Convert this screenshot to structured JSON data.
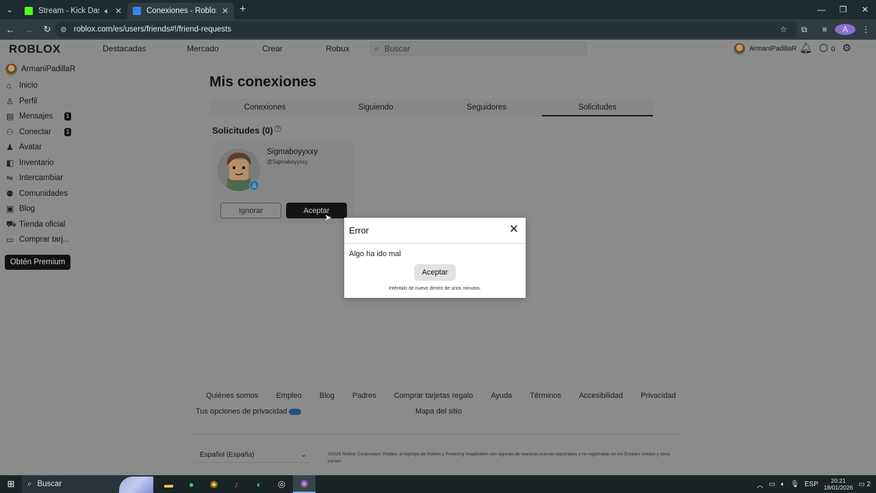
{
  "browser": {
    "tabs": [
      {
        "title": "Stream - Kick Dashboard",
        "active": false
      },
      {
        "title": "Conexiones - Roblox",
        "active": true
      }
    ],
    "url": "roblox.com/es/users/friends#!/friend-requests",
    "profile_initial": "A"
  },
  "topnav": {
    "logo": "ROBLOX",
    "links": [
      "Destacadas",
      "Mercado",
      "Crear",
      "Robux"
    ],
    "search_placeholder": "Buscar",
    "username": "ArmaniPadillaR",
    "robux": "0"
  },
  "sidebar": {
    "username": "ArmaniPadillaR",
    "items": [
      {
        "label": "Inicio",
        "icon": "home-icon"
      },
      {
        "label": "Perfil",
        "icon": "profile-icon"
      },
      {
        "label": "Mensajes",
        "icon": "messages-icon",
        "badge": "1"
      },
      {
        "label": "Conectar",
        "icon": "connect-icon",
        "badge": "1"
      },
      {
        "label": "Avatar",
        "icon": "avatar-icon"
      },
      {
        "label": "Inventario",
        "icon": "inventory-icon"
      },
      {
        "label": "Intercambiar",
        "icon": "trade-icon"
      },
      {
        "label": "Comunidades",
        "icon": "communities-icon"
      },
      {
        "label": "Blog",
        "icon": "blog-icon"
      },
      {
        "label": "Tienda oficial",
        "icon": "store-icon"
      },
      {
        "label": "Comprar tarj...",
        "icon": "giftcard-icon"
      }
    ],
    "premium": "Obtén Premium"
  },
  "main": {
    "title": "Mis conexiones",
    "tabs": [
      "Conexiones",
      "Siguiendo",
      "Seguidores",
      "Solicitudes"
    ],
    "selected_tab": "Solicitudes",
    "requests_heading": "Solicitudes (0)",
    "request": {
      "name": "Sigmaboyyxxy",
      "handle": "@Sigmaboyyxxy",
      "ignore": "Ignorar",
      "accept": "Aceptar"
    }
  },
  "modal": {
    "title": "Error",
    "message": "Algo ha ido mal",
    "button": "Aceptar",
    "note": "Inténtalo de nuevo dentro de unos minutos."
  },
  "footer": {
    "links": [
      "Quiénes somos",
      "Empleo",
      "Blog",
      "Padres",
      "Comprar tarjetas regalo",
      "Ayuda",
      "Términos",
      "Accesibilidad",
      "Privacidad"
    ],
    "privacy_options": "Tus opciones de privacidad",
    "sitemap": "Mapa del sitio",
    "language": "Español (España)",
    "copyright": "©2026 Roblox Corporation. Roblox, el logotipo de Roblox y Powering Imagination son algunas de nuestras marcas registradas y no registradas en los Estados Unidos y otros países."
  },
  "taskbar": {
    "search": "Buscar",
    "lang": "ESP",
    "time": "20:21",
    "date": "18/01/2026",
    "notifications": "2"
  },
  "colors": {
    "overlay_page": "#8b8b8b",
    "modal_bg": "#ffffff",
    "accept_button": "#141414"
  }
}
